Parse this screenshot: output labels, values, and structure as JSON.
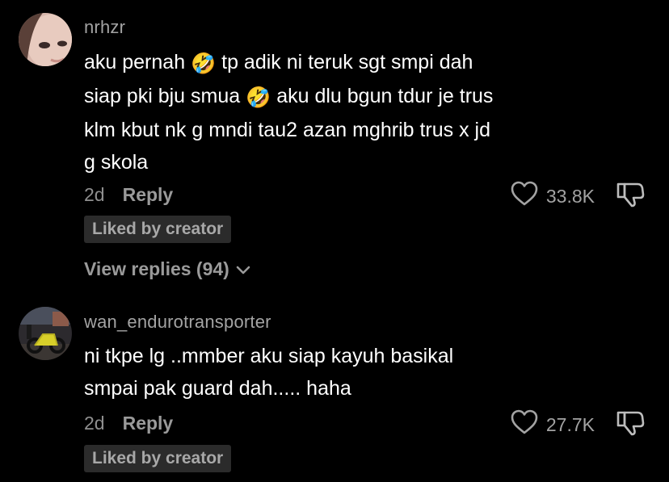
{
  "comments": [
    {
      "username": "nrhzr",
      "text_parts": [
        "aku pernah ",
        " tp adik ni teruk sgt smpi dah\nsiap pki bju smua ",
        " aku dlu bgun tdur je trus\nklm kbut nk g mndi tau2 azan mghrib trus x jd\ng skola"
      ],
      "emoji": "🤣",
      "time": "2d",
      "reply_label": "Reply",
      "likes": "33.8K",
      "badge": "Liked by creator",
      "view_replies": "View replies (94)"
    },
    {
      "username": "wan_endurotransporter",
      "text": "ni tkpe lg ..mmber aku siap kayuh basikal\nsmpai pak guard dah..... haha",
      "time": "2d",
      "reply_label": "Reply",
      "likes": "27.7K",
      "badge": "Liked by creator"
    }
  ],
  "icons": {
    "heart": "heart-outline-icon",
    "dislike": "thumbs-down-icon",
    "chevron": "chevron-down-icon"
  },
  "colors": {
    "background": "#000000",
    "text": "#ffffff",
    "muted": "#a3a3a3",
    "badge_bg": "#2b2b2b"
  }
}
